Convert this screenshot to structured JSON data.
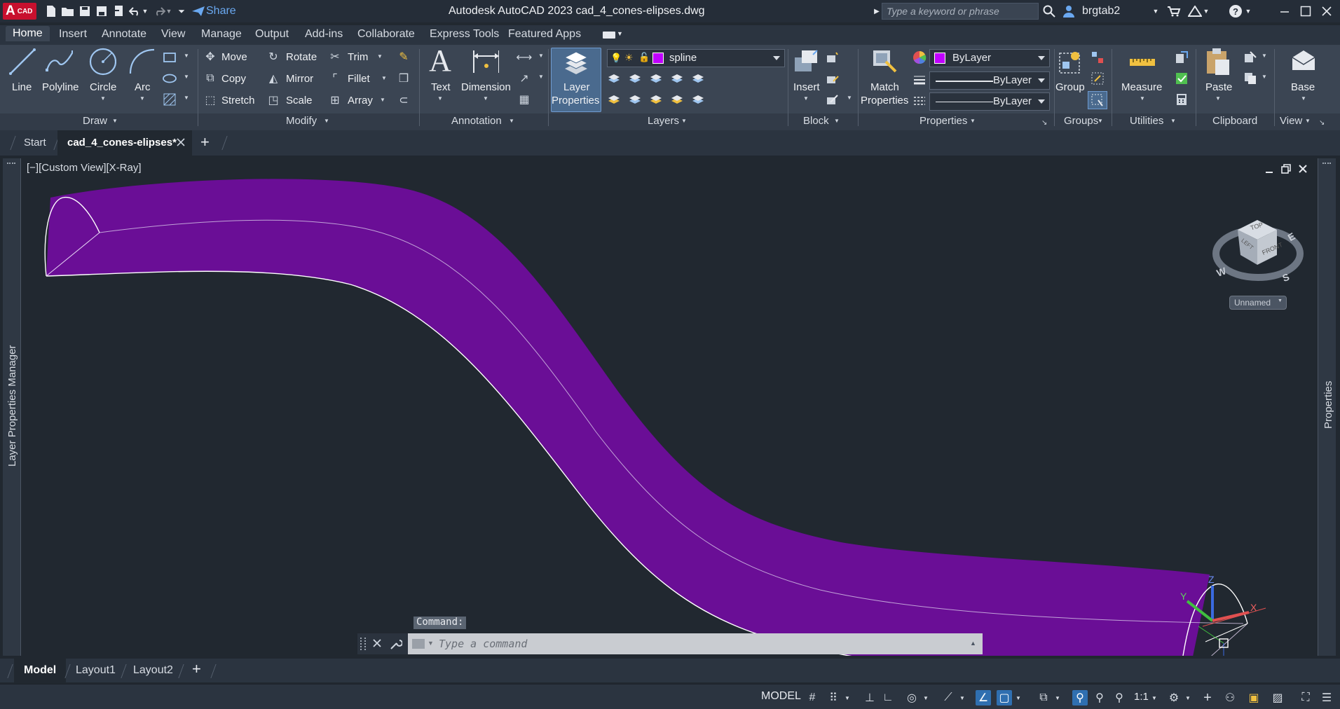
{
  "titlebar": {
    "app_badge": "A",
    "app_badge_small": "CAD",
    "share_label": "Share",
    "title": "Autodesk AutoCAD 2023    cad_4_cones-elipses.dwg",
    "search_placeholder": "Type a keyword or phrase",
    "username": "brgtab2"
  },
  "ribbon_tabs": [
    "Home",
    "Insert",
    "Annotate",
    "View",
    "Manage",
    "Output",
    "Add-ins",
    "Collaborate",
    "Express Tools",
    "Featured Apps"
  ],
  "ribbon": {
    "draw": {
      "title": "Draw",
      "line": "Line",
      "polyline": "Polyline",
      "circle": "Circle",
      "arc": "Arc"
    },
    "modify": {
      "title": "Modify",
      "move": "Move",
      "rotate": "Rotate",
      "trim": "Trim",
      "copy": "Copy",
      "mirror": "Mirror",
      "fillet": "Fillet",
      "stretch": "Stretch",
      "scale": "Scale",
      "array": "Array"
    },
    "annotation": {
      "title": "Annotation",
      "text": "Text",
      "dimension": "Dimension"
    },
    "layers": {
      "title": "Layers",
      "layer_properties_line1": "Layer",
      "layer_properties_line2": "Properties",
      "current_layer": "spline"
    },
    "block": {
      "title": "Block",
      "insert": "Insert"
    },
    "properties": {
      "title": "Properties",
      "match_line1": "Match",
      "match_line2": "Properties",
      "color": "ByLayer",
      "linetype": "ByLayer",
      "lineweight": "ByLayer"
    },
    "groups": {
      "title": "Groups",
      "group": "Group"
    },
    "utilities": {
      "title": "Utilities",
      "measure": "Measure"
    },
    "clipboard": {
      "title": "Clipboard",
      "paste": "Paste"
    },
    "view": {
      "title": "View",
      "base": "Base"
    }
  },
  "doc_tabs": {
    "start": "Start",
    "active": "cad_4_cones-elipses*"
  },
  "viewport": {
    "view_label": "[−][Custom View][X-Ray]",
    "left_palette": "Layer Properties Manager",
    "right_palette": "Properties",
    "viewcube": {
      "top": "TOP",
      "front": "FRONT",
      "left": "LEFT",
      "n_e": "E",
      "s": "S",
      "w": "W",
      "named_view": "Unnamed"
    }
  },
  "command": {
    "label": "Command:",
    "placeholder": "Type a command"
  },
  "layout_tabs": [
    "Model",
    "Layout1",
    "Layout2"
  ],
  "statusbar": {
    "model": "MODEL",
    "scale": "1:1"
  },
  "colors": {
    "accent": "#2f6fb0",
    "solid_fill": "#6a0e96",
    "layer_color": "#c000ff",
    "brand_red": "#c8102e"
  }
}
